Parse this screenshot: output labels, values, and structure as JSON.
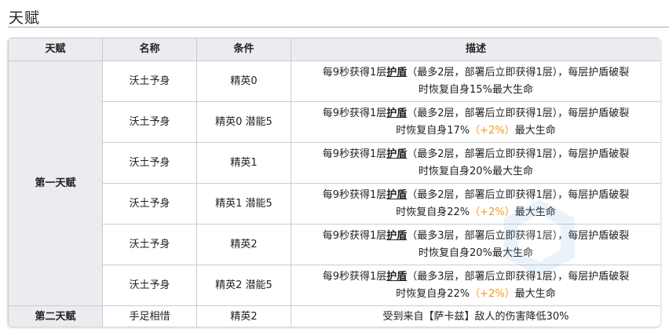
{
  "page": {
    "title": "天赋"
  },
  "table": {
    "headers": [
      "天赋",
      "名称",
      "条件",
      "描述"
    ],
    "group1_label": "第一天赋",
    "group2_label": "第二天赋",
    "keyword": "护盾",
    "rows": [
      {
        "name": "沃土予身",
        "condition": "精英0",
        "line1_pre": "每9秒获得1层",
        "line1_post": "（最多2层，部署后立即获得1层），每层护盾破裂",
        "line2_pre": "时恢复自身15%",
        "bonus": "",
        "line2_post": "最大生命"
      },
      {
        "name": "沃土予身",
        "condition": "精英0 潜能5",
        "line1_pre": "每9秒获得1层",
        "line1_post": "（最多2层，部署后立即获得1层），每层护盾破裂",
        "line2_pre": "时恢复自身17%",
        "bonus": "（+2%）",
        "line2_post": "最大生命"
      },
      {
        "name": "沃土予身",
        "condition": "精英1",
        "line1_pre": "每9秒获得1层",
        "line1_post": "（最多2层，部署后立即获得1层），每层护盾破裂",
        "line2_pre": "时恢复自身20%",
        "bonus": "",
        "line2_post": "最大生命"
      },
      {
        "name": "沃土予身",
        "condition": "精英1 潜能5",
        "line1_pre": "每9秒获得1层",
        "line1_post": "（最多2层，部署后立即获得1层），每层护盾破裂",
        "line2_pre": "时恢复自身22%",
        "bonus": "（+2%）",
        "line2_post": "最大生命"
      },
      {
        "name": "沃土予身",
        "condition": "精英2",
        "line1_pre": "每9秒获得1层",
        "line1_post": "（最多3层，部署后立即获得1层），每层护盾破裂",
        "line2_pre": "时恢复自身20%",
        "bonus": "",
        "line2_post": "最大生命"
      },
      {
        "name": "沃土予身",
        "condition": "精英2 潜能5",
        "line1_pre": "每9秒获得1层",
        "line1_post": "（最多3层，部署后立即获得1层），每层护盾破裂",
        "line2_pre": "时恢复自身22%",
        "bonus": "（+2%）",
        "line2_post": "最大生命"
      }
    ],
    "row2": {
      "name": "手足相惜",
      "condition": "精英2",
      "desc": "受到来自【萨卡兹】敌人的伤害降低30%"
    }
  },
  "colors": {
    "header_bg": "#eaecf0",
    "border": "#c8ccd1",
    "bonus": "#f09b1e"
  }
}
